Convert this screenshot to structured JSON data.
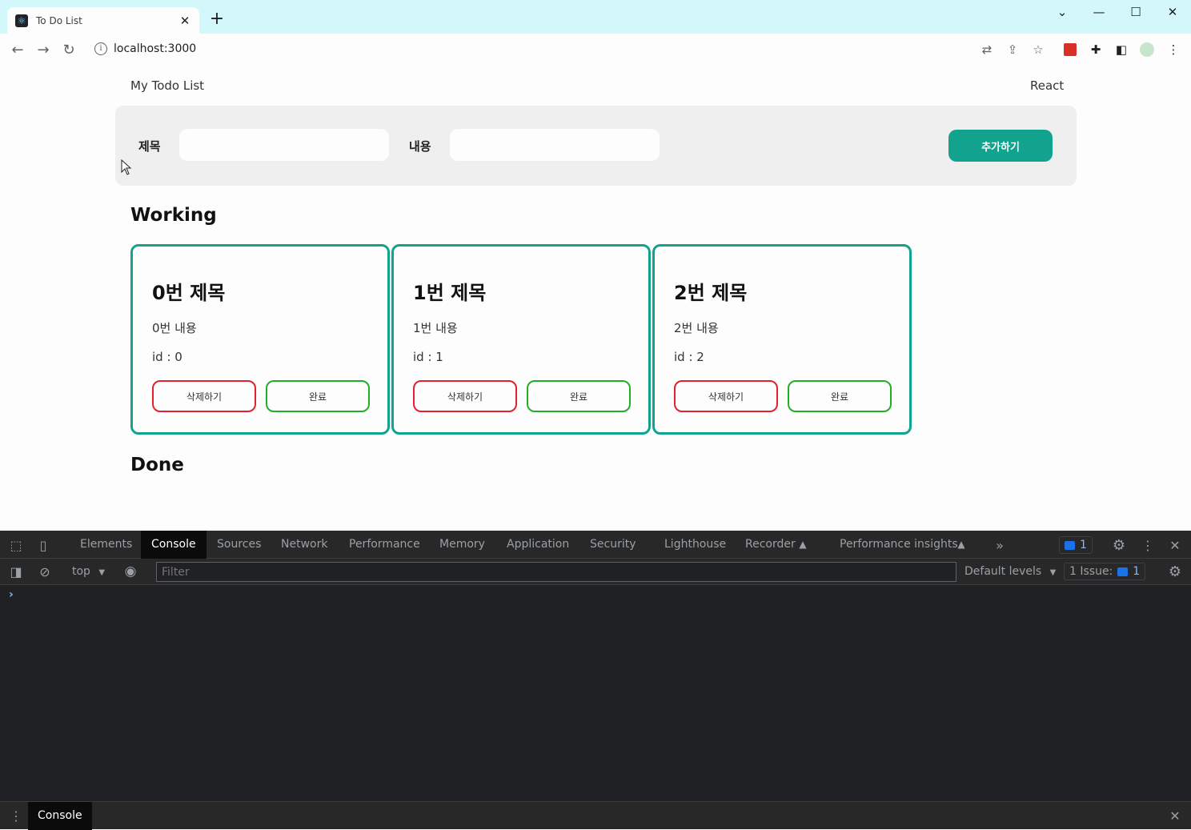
{
  "browser": {
    "tab_title": "To Do List",
    "url": "localhost:3000"
  },
  "app": {
    "header_title": "My Todo List",
    "header_right": "React",
    "form": {
      "title_label": "제목",
      "content_label": "내용",
      "title_value": "",
      "content_value": "",
      "add_button": "추가하기"
    },
    "working_title": "Working",
    "done_title": "Done",
    "cards": [
      {
        "title": "0번 제목",
        "body": "0번 내용",
        "id": "id : 0",
        "delete": "삭제하기",
        "complete": "완료"
      },
      {
        "title": "1번 제목",
        "body": "1번 내용",
        "id": "id : 1",
        "delete": "삭제하기",
        "complete": "완료"
      },
      {
        "title": "2번 제목",
        "body": "2번 내용",
        "id": "id : 2",
        "delete": "삭제하기",
        "complete": "완료"
      }
    ],
    "colors": {
      "accent": "#12a38f",
      "delete_border": "#e3202c",
      "complete_border": "#1fb028"
    }
  },
  "devtools": {
    "tabs": [
      "Elements",
      "Console",
      "Sources",
      "Network",
      "Performance",
      "Memory",
      "Application",
      "Security",
      "Lighthouse",
      "Recorder",
      "Performance insights"
    ],
    "messages_badge": "1",
    "context": "top",
    "filter_placeholder": "Filter",
    "levels": "Default levels",
    "issues_label": "1 Issue:",
    "issues_count": "1",
    "prompt": "›",
    "drawer_tab": "Console"
  }
}
